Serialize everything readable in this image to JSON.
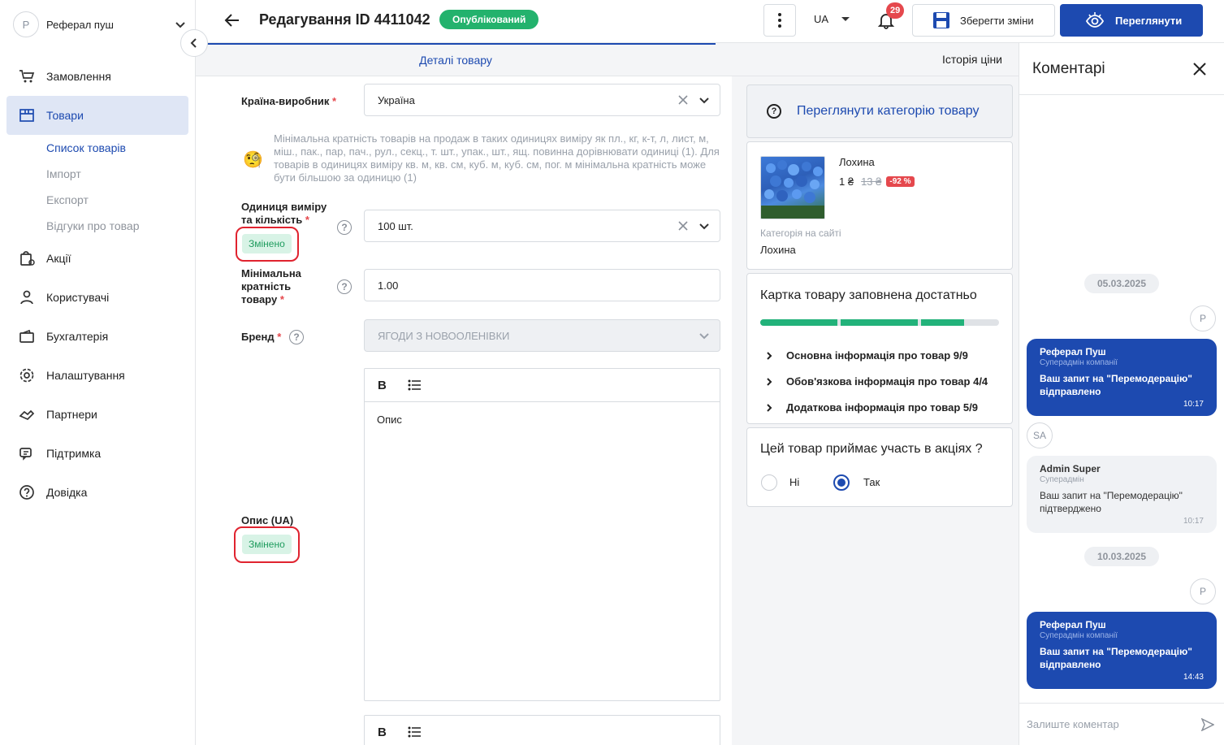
{
  "account": {
    "initial": "Р",
    "name": "Реферал пуш"
  },
  "sidebar": {
    "items": [
      {
        "label": "Замовлення",
        "icon": "cart-icon"
      },
      {
        "label": "Товари",
        "icon": "box-icon",
        "active": true
      },
      {
        "label": "Акції",
        "icon": "promo-icon"
      },
      {
        "label": "Користувачі",
        "icon": "users-icon"
      },
      {
        "label": "Бухгалтерія",
        "icon": "wallet-icon"
      },
      {
        "label": "Налаштування",
        "icon": "gear-icon"
      },
      {
        "label": "Партнери",
        "icon": "handshake-icon"
      },
      {
        "label": "Підтримка",
        "icon": "chat-icon"
      },
      {
        "label": "Довідка",
        "icon": "help-icon"
      }
    ],
    "sub": [
      "Список товарів",
      "Імпорт",
      "Експорт",
      "Відгуки про товар"
    ]
  },
  "header": {
    "title": "Редагування ID 4411042",
    "status": "Опублікований",
    "lang": "UA",
    "notifications": "29",
    "save_label": "Зберегти зміни",
    "view_label": "Переглянути"
  },
  "tabs": {
    "details": "Деталі товару",
    "price_history": "Історія ціни"
  },
  "form": {
    "country_label": "Країна-виробник",
    "country_value": "Україна",
    "hint": "Мінімальна кратність товарів на продаж в таких одиницях виміру як пл., кг, к-т, л, лист, м, міш., пак., пар, пач., рул., секц., т. шт., упак., шт., ящ. повинна дорівнювати одиниці (1). Для товарів в одиницях виміру кв. м, кв. см, куб. м, куб. см, пог. м мінімальна кратність може бути більшою за одиницю (1)",
    "unit_label_1": "Одиниця виміру",
    "unit_label_2": "та кількість",
    "unit_value": "100 шт.",
    "changed": "Змінено",
    "min_label_1": "Мінімальна",
    "min_label_2": "кратність",
    "min_label_3": "товару",
    "min_value": "1.00",
    "brand_label": "Бренд",
    "brand_value": "ЯГОДИ З НОВООЛЕНІВКИ",
    "desc_label": "Опис (UA)",
    "desc_value": "Опис",
    "bold_btn": "B",
    "required": "*",
    "help": "?"
  },
  "info": {
    "category_link": "Переглянути категорію товару",
    "product_name": "Лохина",
    "price": "1 ₴",
    "old_price": "13 ₴",
    "discount": "-92 %",
    "category_label": "Категорія на сайті",
    "category_value": "Лохина",
    "fill_title": "Картка товару заповнена достатньо",
    "fill_rows": [
      "Основна інформація про товар 9/9",
      "Обов'язкова інформація про товар 4/4",
      "Додаткова інформація про товар 5/9"
    ],
    "progress_segments": [
      1.0,
      1.0,
      0.56
    ],
    "promo_title": "Цей товар приймає участь в акціях ?",
    "promo_no": "Ні",
    "promo_yes": "Так"
  },
  "comments": {
    "title": "Коментарі",
    "messages": [
      {
        "date": "05.03.2025",
        "avatar": "Р",
        "author": "Реферал Пуш",
        "role": "Суперадмін компанії",
        "text": "Ваш запит на \"Перемодерацію\" відправлено",
        "time": "10:17"
      },
      {
        "avatar": "SA",
        "author": "Admin Super",
        "role": "Суперадмін",
        "text": "Ваш запит на \"Перемодерацію\" підтверджено",
        "time": "10:17"
      },
      {
        "date": "10.03.2025",
        "avatar": "Р",
        "author": "Реферал Пуш",
        "role": "Суперадмін компанії",
        "text": "Ваш запит на \"Перемодерацію\" відправлено",
        "time": "14:43"
      }
    ],
    "placeholder": "Залиште коментар"
  },
  "colors": {
    "accent": "#1d4ab0",
    "success": "#23b26d",
    "danger": "#e5484d"
  }
}
